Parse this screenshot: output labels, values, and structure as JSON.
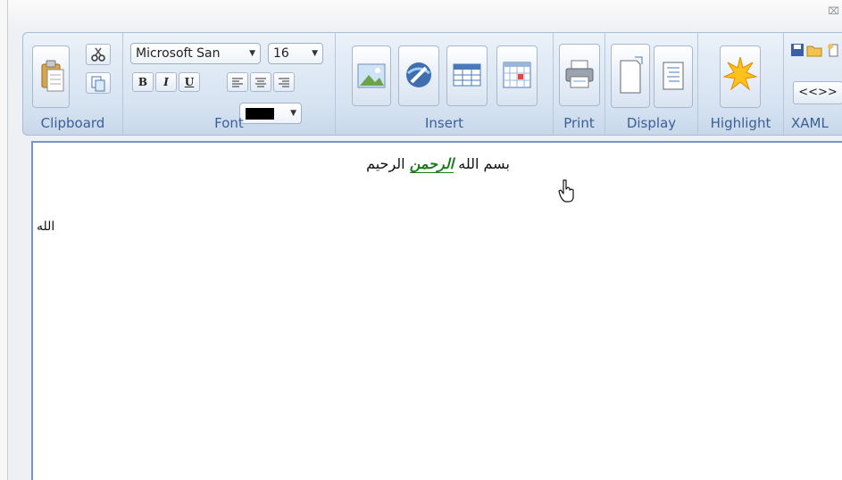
{
  "window": {
    "close_glyph": "⌧"
  },
  "ribbon": {
    "clipboard": {
      "label": "Clipboard"
    },
    "font": {
      "label": "Font",
      "family": "Microsoft San",
      "size": "16",
      "bold": "B",
      "italic": "I",
      "underline": "U",
      "color": "#000000"
    },
    "insert": {
      "label": "Insert"
    },
    "print": {
      "label": "Print"
    },
    "display": {
      "label": "Display"
    },
    "highlight": {
      "label": "Highlight"
    },
    "xaml": {
      "label": "XAML",
      "tag_button": "<<>>"
    }
  },
  "editor": {
    "line1_before": "بسم الله",
    "line1_highlight": "الرحمن",
    "line1_after": "الرحيم",
    "side_word": "الله"
  }
}
